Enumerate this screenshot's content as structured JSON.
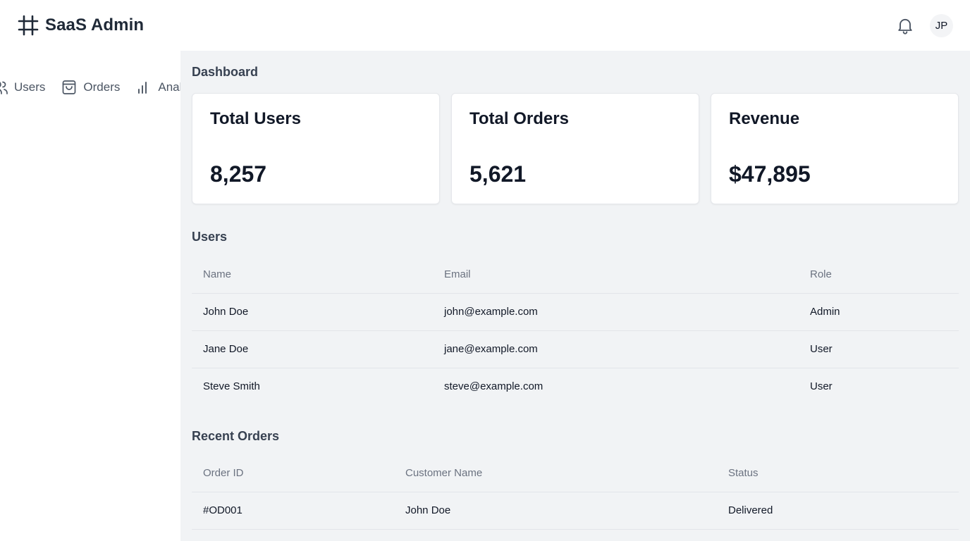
{
  "header": {
    "brand": "SaaS Admin",
    "brand_icon": "hash-icon",
    "notification_icon": "bell-icon",
    "avatar_initials": "JP"
  },
  "sidebar": {
    "items": [
      {
        "label": "Users",
        "icon": "users-icon"
      },
      {
        "label": "Orders",
        "icon": "shopping-bag-icon"
      },
      {
        "label": "Analytics",
        "icon": "bar-chart-icon"
      }
    ]
  },
  "main": {
    "page_title": "Dashboard",
    "stats": [
      {
        "label": "Total Users",
        "value": "8,257"
      },
      {
        "label": "Total Orders",
        "value": "5,621"
      },
      {
        "label": "Revenue",
        "value": "$47,895"
      }
    ],
    "users": {
      "title": "Users",
      "columns": [
        "Name",
        "Email",
        "Role"
      ],
      "rows": [
        [
          "John Doe",
          "john@example.com",
          "Admin"
        ],
        [
          "Jane Doe",
          "jane@example.com",
          "User"
        ],
        [
          "Steve Smith",
          "steve@example.com",
          "User"
        ]
      ]
    },
    "orders": {
      "title": "Recent Orders",
      "columns": [
        "Order ID",
        "Customer Name",
        "Status"
      ],
      "rows": [
        [
          "#OD001",
          "John Doe",
          "Delivered"
        ]
      ]
    }
  },
  "colors": {
    "main_background": "#f1f3f5",
    "card_background": "#ffffff",
    "text_primary": "#111827",
    "text_muted": "#6b7280"
  }
}
